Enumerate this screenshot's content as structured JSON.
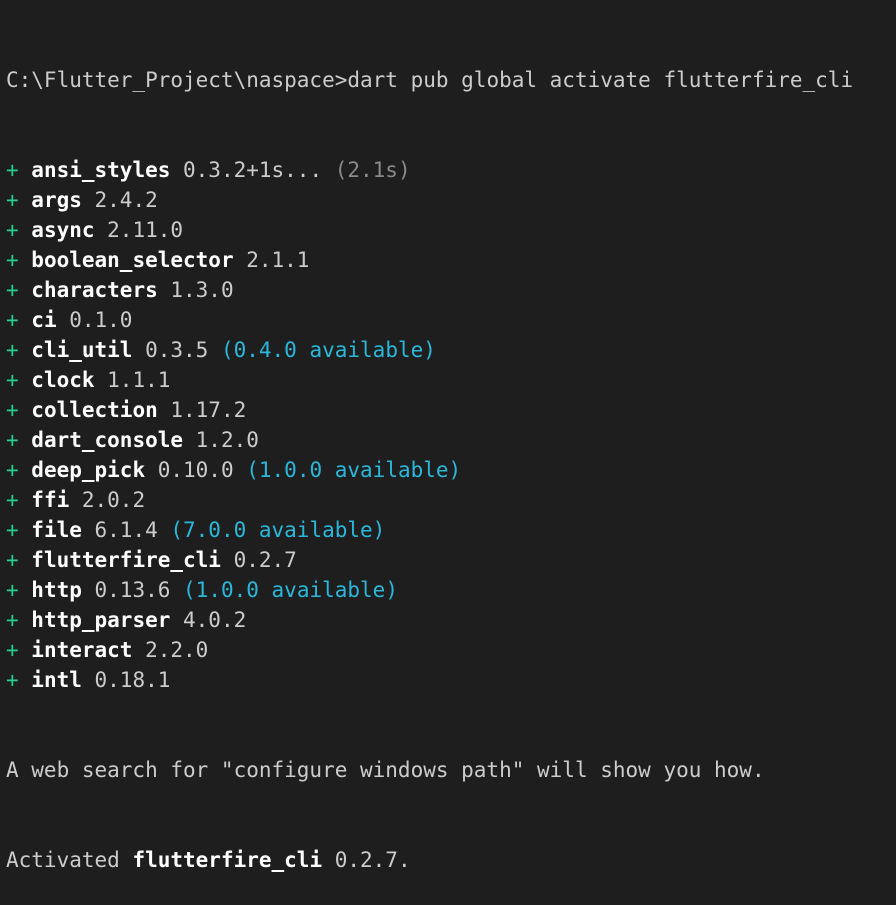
{
  "terminal": {
    "prompt": "C:\\Flutter_Project\\naspace>",
    "command": "dart pub global activate flutterfire_cli",
    "packages": [
      {
        "prefix": "+ ",
        "name": "ansi_styles",
        "version": " 0.3.2+1s...",
        "note": "",
        "timing": " (2.1s)"
      },
      {
        "prefix": "+ ",
        "name": "args",
        "version": " 2.4.2",
        "note": "",
        "timing": ""
      },
      {
        "prefix": "+ ",
        "name": "async",
        "version": " 2.11.0",
        "note": "",
        "timing": ""
      },
      {
        "prefix": "+ ",
        "name": "boolean_selector",
        "version": " 2.1.1",
        "note": "",
        "timing": ""
      },
      {
        "prefix": "+ ",
        "name": "characters",
        "version": " 1.3.0",
        "note": "",
        "timing": ""
      },
      {
        "prefix": "+ ",
        "name": "ci",
        "version": " 0.1.0",
        "note": "",
        "timing": ""
      },
      {
        "prefix": "+ ",
        "name": "cli_util",
        "version": " 0.3.5",
        "note": " (0.4.0 available)",
        "timing": ""
      },
      {
        "prefix": "+ ",
        "name": "clock",
        "version": " 1.1.1",
        "note": "",
        "timing": ""
      },
      {
        "prefix": "+ ",
        "name": "collection",
        "version": " 1.17.2",
        "note": "",
        "timing": ""
      },
      {
        "prefix": "+ ",
        "name": "dart_console",
        "version": " 1.2.0",
        "note": "",
        "timing": ""
      },
      {
        "prefix": "+ ",
        "name": "deep_pick",
        "version": " 0.10.0",
        "note": " (1.0.0 available)",
        "timing": ""
      },
      {
        "prefix": "+ ",
        "name": "ffi",
        "version": " 2.0.2",
        "note": "",
        "timing": ""
      },
      {
        "prefix": "+ ",
        "name": "file",
        "version": " 6.1.4",
        "note": " (7.0.0 available)",
        "timing": ""
      },
      {
        "prefix": "+ ",
        "name": "flutterfire_cli",
        "version": " 0.2.7",
        "note": "",
        "timing": ""
      },
      {
        "prefix": "+ ",
        "name": "http",
        "version": " 0.13.6",
        "note": " (1.0.0 available)",
        "timing": ""
      },
      {
        "prefix": "+ ",
        "name": "http_parser",
        "version": " 4.0.2",
        "note": "",
        "timing": ""
      },
      {
        "prefix": "+ ",
        "name": "interact",
        "version": " 2.2.0",
        "note": "",
        "timing": ""
      },
      {
        "prefix": "+ ",
        "name": "intl",
        "version": " 0.18.1",
        "note": "",
        "timing": ""
      }
    ],
    "hint": "A web search for \"configure windows path\" will show you how.",
    "activated_prefix": "Activated ",
    "activated_name": "flutterfire_cli",
    "activated_version": " 0.2.7."
  },
  "colors": {
    "background": "#1e1e1e",
    "text": "#cccccc",
    "plus": "#23d18b",
    "available": "#29b8db",
    "timing": "#8a8a8a"
  }
}
